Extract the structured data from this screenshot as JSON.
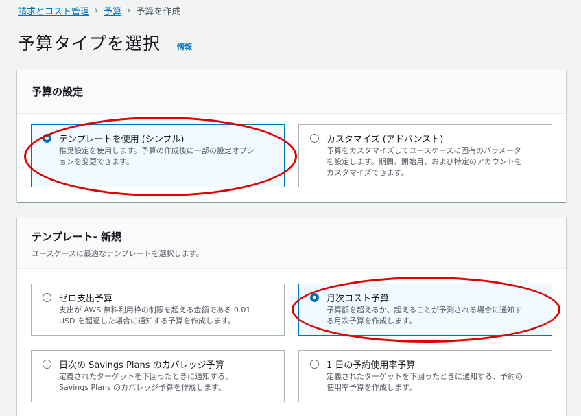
{
  "breadcrumb": {
    "items": [
      "請求とコスト管理",
      "予算"
    ],
    "current": "予算を作成",
    "separator": "›"
  },
  "page": {
    "title": "予算タイプを選択",
    "info": "情報"
  },
  "budget_setup": {
    "title": "予算の設定",
    "options": [
      {
        "label": "テンプレートを使用 (シンプル)",
        "desc_lines": [
          "推奨設定を使用します。予算の作成後に一部の設定オプシ",
          "ョンを変更できます。"
        ],
        "selected": true
      },
      {
        "label": "カスタマイズ (アドバンスト)",
        "desc_lines": [
          "予算をカスタマイズしてユースケースに固有のパラメータ",
          "を設定します。期間、開始月、および特定のアカウントを",
          "カスタマイズできます。"
        ],
        "selected": false
      }
    ]
  },
  "templates": {
    "title": "テンプレート- 新規",
    "description": "ユースケースに最適なテンプレートを選択します。",
    "options": [
      {
        "label": "ゼロ支出予算",
        "desc_lines": [
          "支出が AWS 無料利用枠の制限を超える金額である 0.01",
          "USD を超過した場合に通知する予算を作成します。"
        ],
        "selected": false
      },
      {
        "label": "月次コスト予算",
        "desc_lines": [
          "予算額を超えるか、超えることが予測される場合に通知す",
          "る月次予算を作成します。"
        ],
        "selected": true
      },
      {
        "label": "日次の Savings Plans のカバレッジ予算",
        "desc_lines": [
          "定義されたターゲットを下回ったときに通知する、",
          "Savings Plans のカバレッジ予算を作成します。"
        ],
        "selected": false
      },
      {
        "label": "1 日の予約使用率予算",
        "desc_lines": [
          "定義されたターゲットを下回ったときに通知する、予約の",
          "使用率予算を作成します。"
        ],
        "selected": false
      }
    ]
  },
  "colors": {
    "link": "#0073bb",
    "selected_border": "#0073bb",
    "selected_bg": "#f1faff",
    "annotation": "#e00000"
  }
}
